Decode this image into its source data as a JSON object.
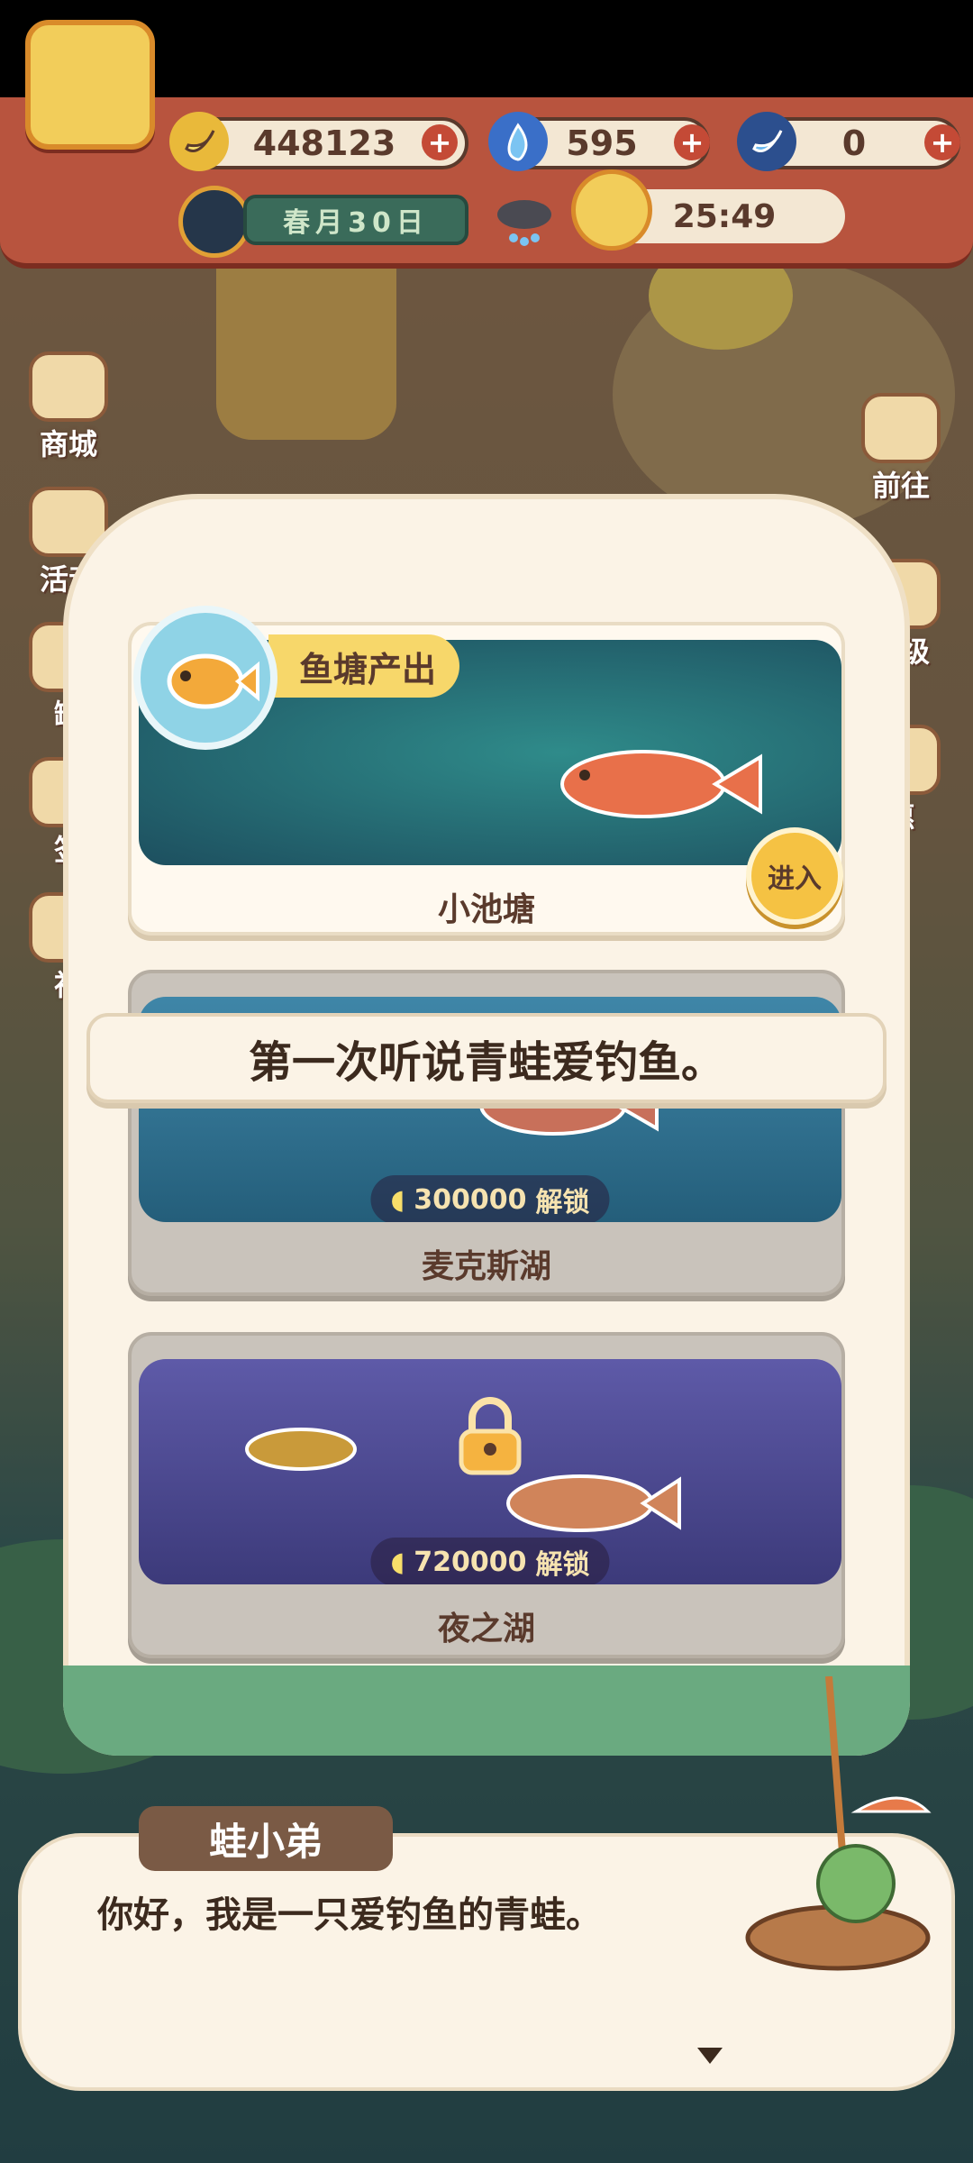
{
  "hud": {
    "bananas": "448123",
    "flames": "595",
    "blue_bananas": "0",
    "date_text": "春月30日",
    "timer": "25:49"
  },
  "side_menu": {
    "left": [
      {
        "label": "商城"
      },
      {
        "label": "活动"
      },
      {
        "label": "罐"
      },
      {
        "label": "签"
      },
      {
        "label": "神"
      }
    ],
    "right": [
      {
        "label": "前往"
      },
      {
        "label": "等级"
      },
      {
        "label": "惠"
      }
    ]
  },
  "panel": {
    "badge_label": "鱼塘产出",
    "ponds": [
      {
        "name": "小池塘",
        "enter_label": "进入",
        "locked": false
      },
      {
        "name": "麦克斯湖",
        "unlock_cost": "300000",
        "unlock_label": "解锁",
        "locked": true
      },
      {
        "name": "夜之湖",
        "unlock_cost": "720000",
        "unlock_label": "解锁",
        "locked": true
      }
    ]
  },
  "banner": {
    "text": "第一次听说青蛙爱钓鱼。"
  },
  "dialog": {
    "speaker": "蛙小弟",
    "text": "你好，我是一只爱钓鱼的青蛙。"
  },
  "colors": {
    "hud_red": "#b8543e",
    "panel_cream": "#fbf3e6",
    "accent_yellow": "#f5c243",
    "text_brown": "#5a3a2c"
  }
}
